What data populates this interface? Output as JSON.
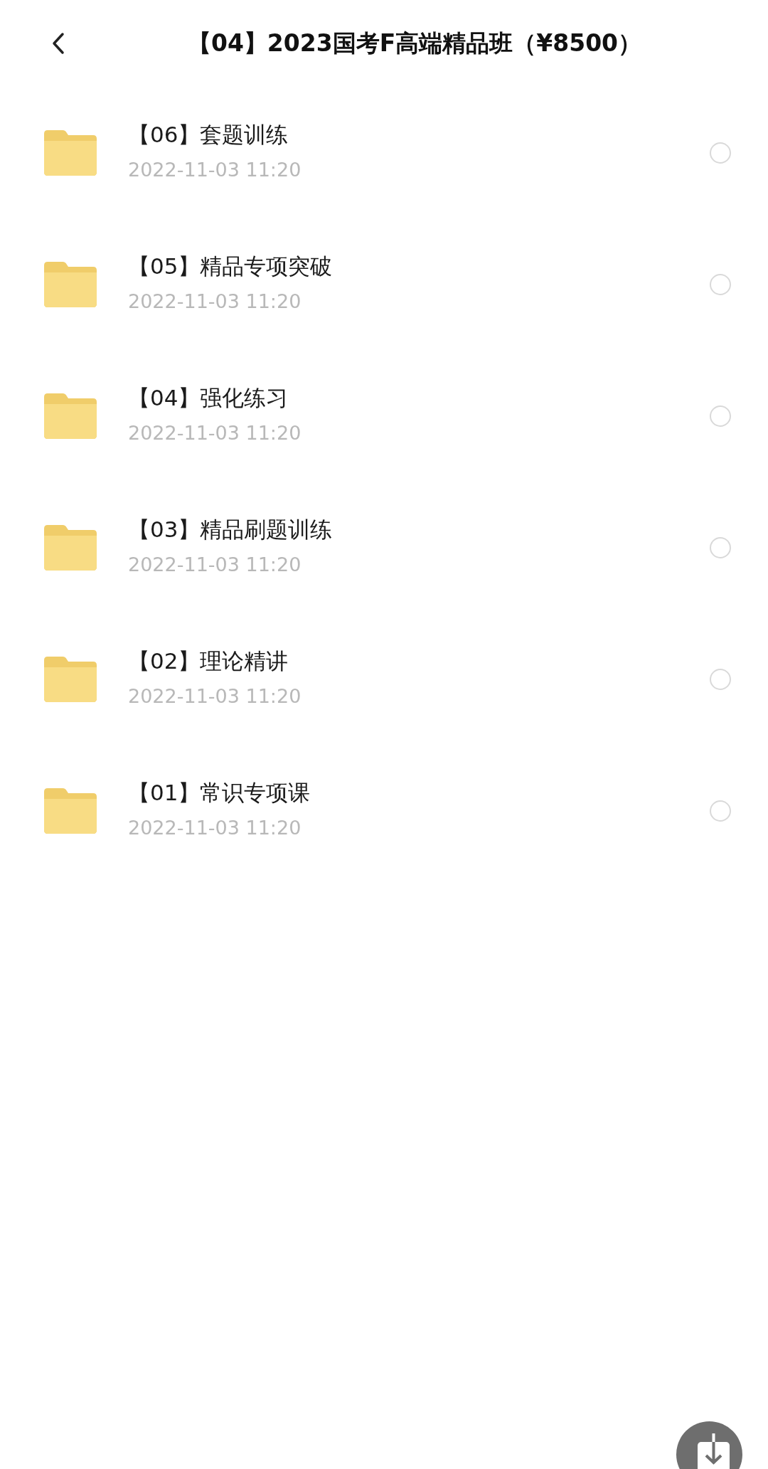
{
  "header": {
    "title": "【04】2023国考F高端精品班（¥8500）"
  },
  "items": [
    {
      "name": "【06】套题训练",
      "date": "2022-11-03 11:20",
      "selected": false
    },
    {
      "name": "【05】精品专项突破",
      "date": "2022-11-03 11:20",
      "selected": false
    },
    {
      "name": "【04】强化练习",
      "date": "2022-11-03 11:20",
      "selected": false
    },
    {
      "name": "【03】精品刷题训练",
      "date": "2022-11-03 11:20",
      "selected": false
    },
    {
      "name": "【02】理论精讲",
      "date": "2022-11-03 11:20",
      "selected": false
    },
    {
      "name": "【01】常识专项课",
      "date": "2022-11-03 11:20",
      "selected": false
    }
  ]
}
